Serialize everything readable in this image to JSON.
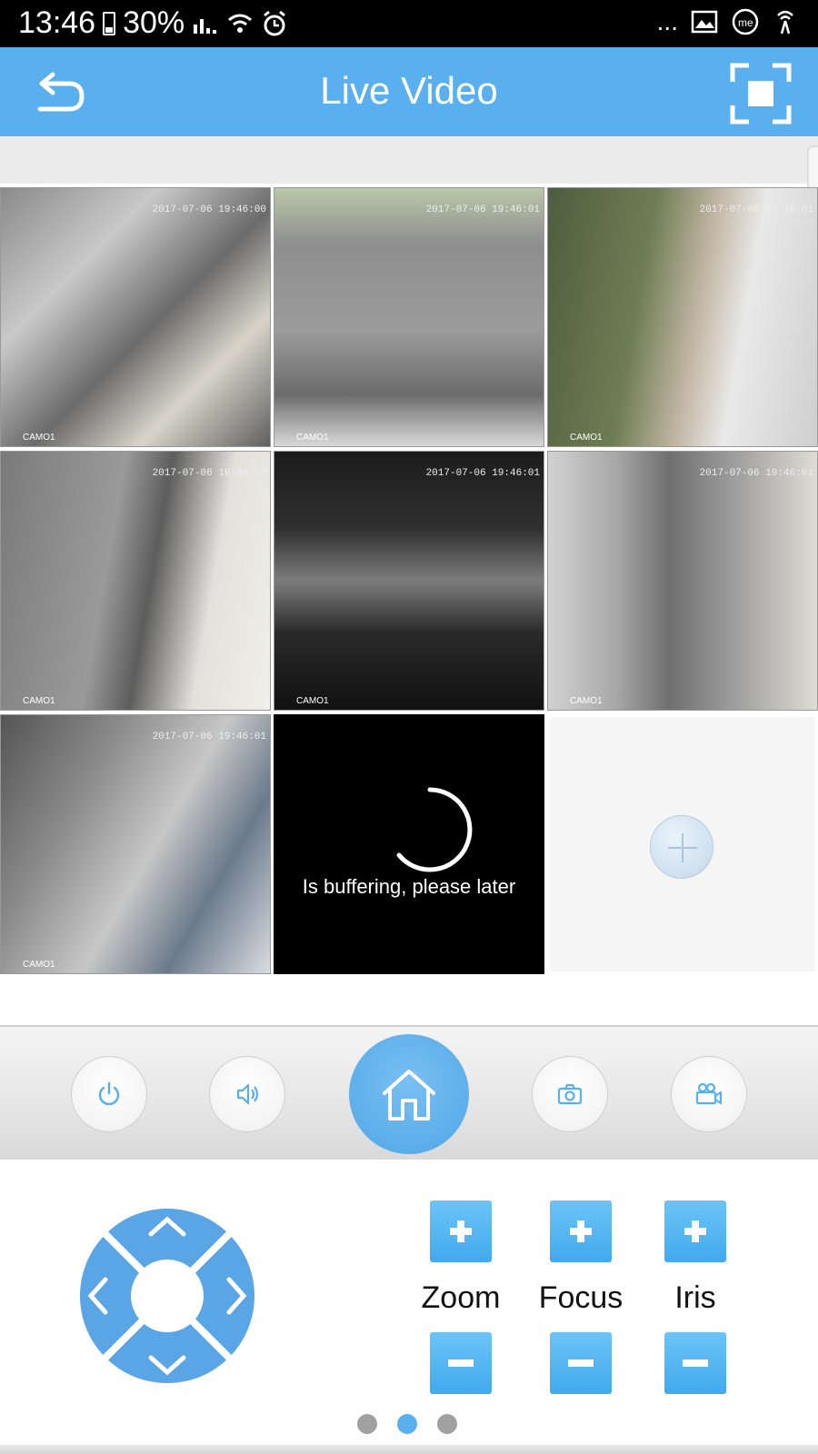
{
  "status_bar": {
    "time": "13:46",
    "battery": "30%",
    "overflow": "...",
    "icons": [
      "battery-icon",
      "signal-icon",
      "wifi-icon",
      "alarm-icon",
      "gallery-icon",
      "app-icon",
      "hotspot-icon"
    ]
  },
  "header": {
    "title": "Live Video",
    "back_icon": "back-arrow-icon",
    "fullscreen_icon": "fullscreen-icon"
  },
  "video_grid": {
    "tiles": [
      {
        "timestamp": "2017-07-06 19:46:00",
        "camera": "CAMO1"
      },
      {
        "timestamp": "2017-07-06 19:46:01",
        "camera": "CAMO1"
      },
      {
        "timestamp": "2017-07-06 19:46:01",
        "camera": "CAMO1"
      },
      {
        "timestamp": "2017-07-06 19:46:00",
        "camera": "CAMO1"
      },
      {
        "timestamp": "2017-07-06 19:46:01",
        "camera": "CAMO1"
      },
      {
        "timestamp": "2017-07-06 19:46:01",
        "camera": "CAMO1"
      },
      {
        "timestamp": "2017-07-06 19:46:01",
        "camera": "CAMO1"
      }
    ],
    "buffering_text": "Is buffering, please later",
    "add_icon": "plus-icon"
  },
  "toolbar": {
    "buttons": [
      "power-icon",
      "speaker-icon",
      "home-icon",
      "camera-icon",
      "video-record-icon"
    ]
  },
  "ptz": {
    "dpad_icon": "direction-pad-icon",
    "zoom_label": "Zoom",
    "focus_label": "Focus",
    "iris_label": "Iris"
  },
  "pager": {
    "count": 3,
    "active_index": 1
  },
  "colors": {
    "header": "#5ab0ef",
    "accent": "#41a9ee",
    "pager_active": "#5ab0ef"
  }
}
